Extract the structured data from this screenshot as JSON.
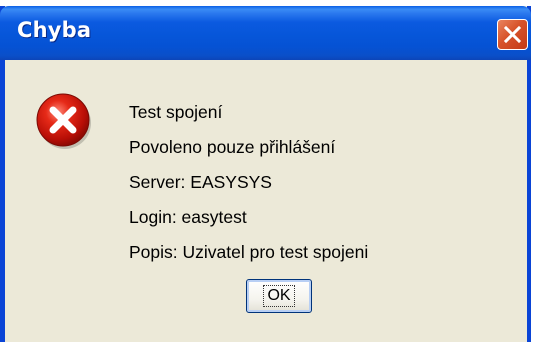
{
  "window": {
    "title": "Chyba",
    "icons": {
      "close": "close-icon",
      "status": "error-icon"
    },
    "colors": {
      "titlebar": "#0656d9",
      "close_button": "#d7522a",
      "body": "#ece9d8",
      "error": "#d61010"
    }
  },
  "message": {
    "lines": [
      "Test spojení",
      "Povoleno pouze přihlášení",
      "Server: EASYSYS",
      "Login: easytest",
      "Popis: Uzivatel pro test spojeni"
    ]
  },
  "buttons": {
    "ok_label": "OK"
  }
}
